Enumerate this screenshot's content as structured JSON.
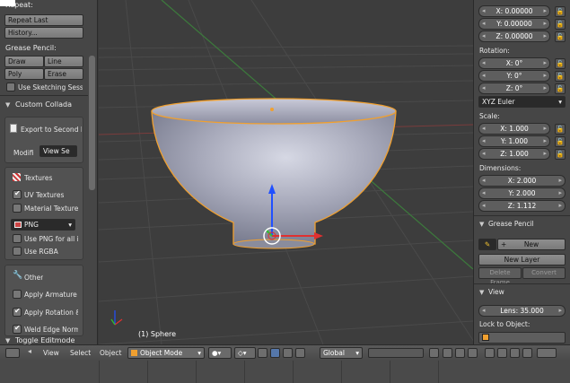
{
  "left_panel": {
    "repeat_header": "Repeat:",
    "repeat_last": "Repeat Last",
    "history": "History...",
    "grease_header": "Grease Pencil:",
    "draw": "Draw",
    "line": "Line",
    "poly": "Poly",
    "erase": "Erase",
    "use_sketching": "Use Sketching Sessi",
    "collada_header": "Custom Collada",
    "export_second": "Export to Second Li",
    "modifi": "Modifi",
    "view_se": "View Se",
    "textures_header": "Textures",
    "uv_textures": "UV Textures",
    "material_texture": "Material Texture",
    "png": "PNG",
    "use_png": "Use PNG for all i",
    "use_rgba": "Use RGBA",
    "other_header": "Other",
    "apply_armature": "Apply Armature",
    "apply_rotation": "Apply Rotation &",
    "weld_edge": "Weld Edge Norm",
    "toggle_editmode": "Toggle Editmode"
  },
  "viewport": {
    "object_info": "(1) Sphere"
  },
  "right_panel": {
    "location": {
      "x": "X: 0.00000",
      "y": "Y: 0.00000",
      "z": "Z: 0.00000"
    },
    "rotation_header": "Rotation:",
    "rotation": {
      "x": "X: 0°",
      "y": "Y: 0°",
      "z": "Z: 0°"
    },
    "rotation_mode": "XYZ Euler",
    "scale_header": "Scale:",
    "scale": {
      "x": "X: 1.000",
      "y": "Y: 1.000",
      "z": "Z: 1.000"
    },
    "dimensions_header": "Dimensions:",
    "dimensions": {
      "x": "X: 2.000",
      "y": "Y: 2.000",
      "z": "Z: 1.112"
    },
    "grease_header": "Grease Pencil",
    "new": "New",
    "new_layer": "New Layer",
    "delete_frame": "Delete Frame",
    "convert": "Convert",
    "view_header": "View",
    "lens": "Lens: 35.000",
    "lock_to_object": "Lock to Object:"
  },
  "bottom_bar": {
    "menu_view": "View",
    "menu_select": "Select",
    "menu_object": "Object",
    "mode": "Object Mode",
    "orientation": "Global"
  },
  "colors": {
    "accent_selection": "#f0a030",
    "axis_x": "#e03030",
    "axis_y": "#30c030",
    "axis_z": "#2050ff"
  }
}
